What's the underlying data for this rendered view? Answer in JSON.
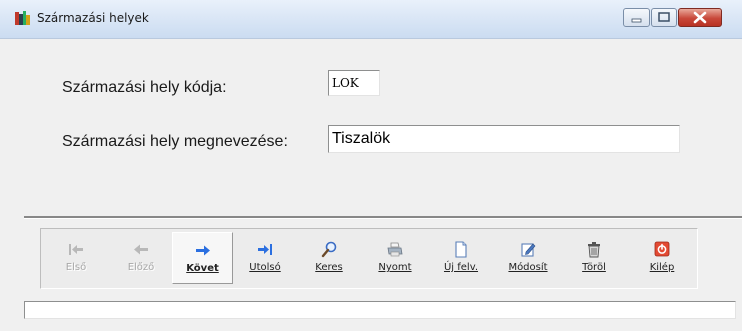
{
  "window": {
    "title": "Származási helyek"
  },
  "form": {
    "code_label": "Származási hely kódja:",
    "code_value": "LOK",
    "name_label": "Származási hely megnevezése:",
    "name_value": "Tiszalök"
  },
  "toolbar": {
    "buttons": [
      {
        "label": "Első",
        "icon": "first-arrow-icon",
        "enabled": false
      },
      {
        "label": "Előző",
        "icon": "left-arrow-icon",
        "enabled": false
      },
      {
        "label": "Követ",
        "icon": "right-arrow-icon",
        "enabled": true,
        "active": true
      },
      {
        "label": "Utolsó",
        "icon": "last-arrow-icon",
        "enabled": true
      },
      {
        "label": "Keres",
        "icon": "magnifier-icon",
        "enabled": true
      },
      {
        "label": "Nyomt",
        "icon": "printer-icon",
        "enabled": true
      },
      {
        "label": "Új felv.",
        "icon": "new-document-icon",
        "enabled": true
      },
      {
        "label": "Módosít",
        "icon": "edit-icon",
        "enabled": true
      },
      {
        "label": "Töröl",
        "icon": "trash-icon",
        "enabled": true
      },
      {
        "label": "Kilép",
        "icon": "exit-icon",
        "enabled": true
      }
    ]
  },
  "colors": {
    "arrow_blue": "#2b6fe0",
    "disabled_gray": "#a8a8a8",
    "close_red": "#c8483a"
  },
  "status_bar": {
    "text": ""
  }
}
